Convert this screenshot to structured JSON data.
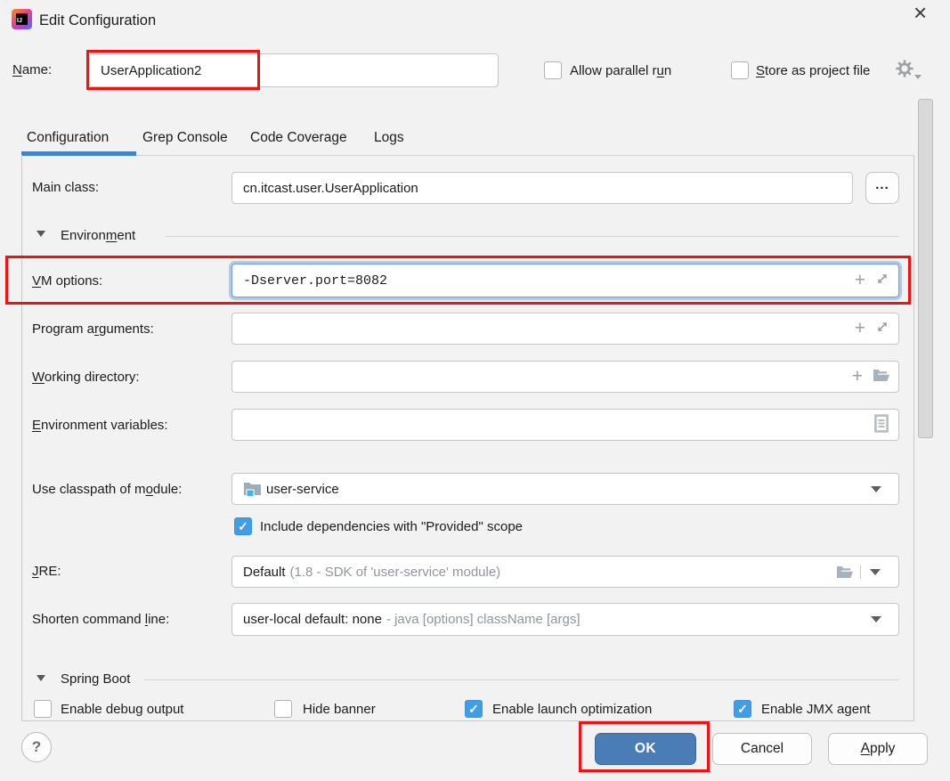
{
  "window": {
    "title": "Edit Configuration"
  },
  "icons": {
    "close": "×",
    "browse": "...",
    "plus": "+",
    "help": "?",
    "check": "✓",
    "collapse_triangle": "section-collapse",
    "gear": "settings-gear",
    "expand": "expand-field",
    "folder": "browse-folder",
    "module": "module-folder",
    "env_list": "environment-variables-list"
  },
  "name_row": {
    "label": {
      "text": "Name:",
      "u": 0
    },
    "value": "UserApplication2",
    "allow_parallel": {
      "label": {
        "text": "Allow parallel run",
        "u": 16
      },
      "checked": false
    },
    "store_as_project": {
      "label": {
        "text": "Store as project file",
        "u": 0
      },
      "checked": false
    }
  },
  "tabs": [
    {
      "label": "Configuration",
      "active": true
    },
    {
      "label": "Grep Console",
      "active": false
    },
    {
      "label": "Code Coverage",
      "active": false
    },
    {
      "label": "Logs",
      "active": false
    }
  ],
  "form": {
    "main_class": {
      "label": "Main class:",
      "value": "cn.itcast.user.UserApplication"
    },
    "environment_section": {
      "label": {
        "text": "Environment",
        "u": 7
      },
      "expanded": true
    },
    "vm_options": {
      "label": {
        "text": "VM options:",
        "u": 0
      },
      "value": "-Dserver.port=8082",
      "focused": true,
      "highlighted": true
    },
    "program_arguments": {
      "label": {
        "text": "Program arguments:",
        "u": 9
      },
      "value": ""
    },
    "working_directory": {
      "label": {
        "text": "Working directory:",
        "u": 0
      },
      "value": ""
    },
    "environment_variables": {
      "label": {
        "text": "Environment variables:",
        "u": 0
      },
      "value": ""
    },
    "use_classpath": {
      "label": {
        "text": "Use classpath of module:",
        "u": 18
      },
      "value": "user-service"
    },
    "include_dependencies": {
      "label": "Include dependencies with \"Provided\" scope",
      "checked": true
    },
    "jre": {
      "label": {
        "text": "JRE:",
        "u": 0
      },
      "value_main": "Default",
      "value_hint": "(1.8 - SDK of 'user-service' module)"
    },
    "shorten_command_line": {
      "label": {
        "text": "Shorten command line:",
        "u": 16
      },
      "value_main": "user-local default: none",
      "value_hint": "- java [options] className [args]"
    },
    "spring_boot_section": {
      "label": "Spring Boot",
      "expanded": true
    },
    "spring_checkboxes": [
      {
        "label": "Enable debug output",
        "checked": false
      },
      {
        "label": "Hide banner",
        "checked": false
      },
      {
        "label": "Enable launch optimization",
        "checked": true
      },
      {
        "label": "Enable JMX agent",
        "checked": true
      }
    ]
  },
  "footer": {
    "help": "?",
    "ok": "OK",
    "ok_highlighted": true,
    "cancel": "Cancel",
    "apply": {
      "text": "Apply",
      "u": 0
    }
  },
  "colors": {
    "dialog_bg": "#f2f2f2",
    "tab_underline_blue": "#4184c8",
    "checkbox_checked_blue": "#419de4",
    "ok_button_blue": "#4a7cb5",
    "highlight_red": "#f21111",
    "focus_ring_blue": "#6f9fd8",
    "hint_gray": "#8e969b"
  }
}
